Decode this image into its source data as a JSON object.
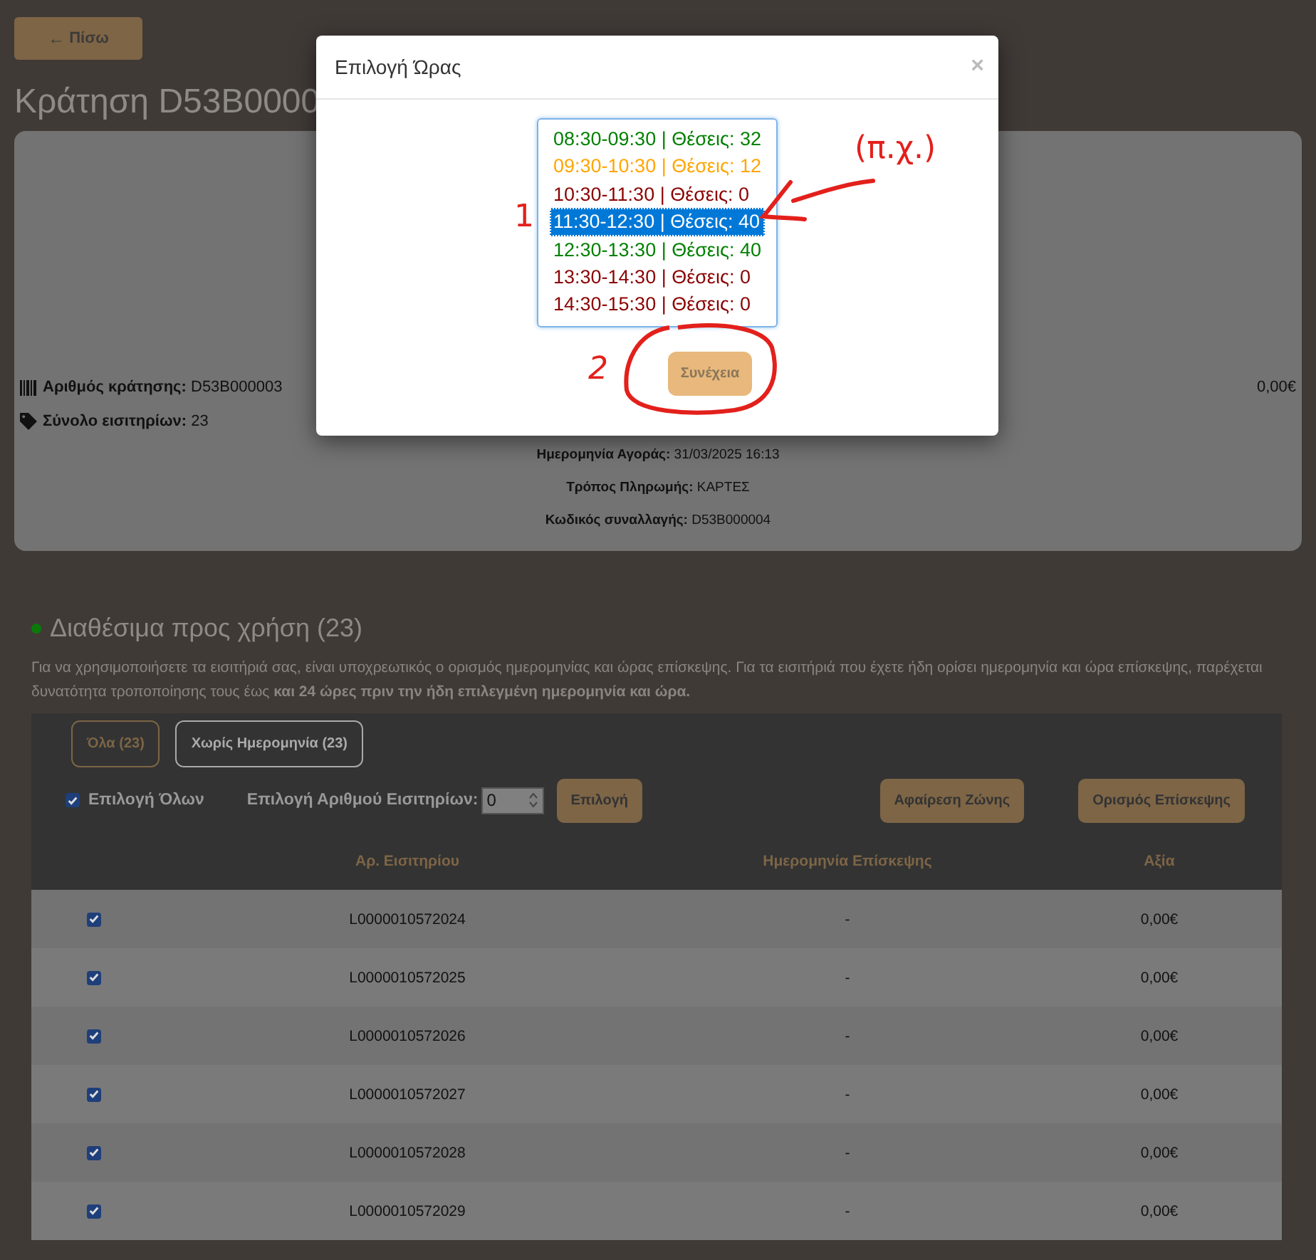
{
  "back_button": {
    "icon": "←",
    "label": "Πίσω"
  },
  "title": "Κράτηση D53B0000",
  "booking": {
    "number": "**Αριθμός κράτησης:** D53B000003",
    "total_tickets": "**Σύνολο εισιτηρίων:** 23",
    "amount": "0,00€",
    "details": [
      "**Ημερομηνία Αγοράς:** 31/03/2025 16:13",
      "**Τρόπος Πληρωμής:** ΚΑΡΤΕΣ",
      "**Κωδικός συναλλαγής:** D53B000004"
    ]
  },
  "section": {
    "title": "Διαθέσιμα προς χρήση (23)",
    "note": "Για να χρησιμοποιήσετε τα εισιτήριά σας, είναι υποχρεωτικός ο ορισμός ημερομηνίας και ώρας επίσκεψης. Για τα εισιτήριά που έχετε ήδη ορίσει ημερομηνία και ώρα επίσκεψης, παρέχεται δυνατότητα τροποποίησης τους έως **και 24 ώρες πριν την ήδη επιλεγμένη ημερομηνία και ώρα.**"
  },
  "filters": [
    {
      "label": "Όλα (23)",
      "selected": true
    },
    {
      "label": "Χωρίς Ημερομηνία (23)",
      "selected": false
    }
  ],
  "select_all": {
    "label": "Επιλογή Όλων",
    "checked": true
  },
  "count_field": {
    "label": "Επιλογή Αριθμού Εισιτηρίων:",
    "value": "0"
  },
  "actions": [
    "Επιλογή",
    "Αφαίρεση Ζώνης",
    "Ορισμός Επίσκεψης"
  ],
  "table": {
    "columns": [
      "Αρ. Εισιτηρίου",
      "Ημερομηνία Επίσκεψης",
      "Αξία"
    ],
    "rows": [
      {
        "checked": true,
        "cells": [
          "L0000010572024",
          "-",
          "0,00€"
        ]
      },
      {
        "checked": true,
        "cells": [
          "L0000010572025",
          "-",
          "0,00€"
        ]
      },
      {
        "checked": true,
        "cells": [
          "L0000010572026",
          "-",
          "0,00€"
        ]
      },
      {
        "checked": true,
        "cells": [
          "L0000010572027",
          "-",
          "0,00€"
        ]
      },
      {
        "checked": true,
        "cells": [
          "L0000010572028",
          "-",
          "0,00€"
        ]
      },
      {
        "checked": true,
        "cells": [
          "L0000010572029",
          "-",
          "0,00€"
        ]
      }
    ]
  },
  "modal": {
    "title": "Επιλογή Ώρας",
    "close": "×",
    "options": [
      {
        "label": "08:30-09:30 | Θέσεις: 32",
        "color": "#008000",
        "selected": false
      },
      {
        "label": "09:30-10:30 | Θέσεις: 12",
        "color": "#ffa500",
        "selected": false
      },
      {
        "label": "10:30-11:30 | Θέσεις: 0",
        "color": "#8b0000",
        "selected": false
      },
      {
        "label": "11:30-12:30 | Θέσεις: 40",
        "selected": true
      },
      {
        "label": "12:30-13:30 | Θέσεις: 40",
        "color": "#008000",
        "selected": false
      },
      {
        "label": "13:30-14:30 | Θέσεις: 0",
        "color": "#8b0000",
        "selected": false
      },
      {
        "label": "14:30-15:30 | Θέσεις: 0",
        "color": "#8b0000",
        "selected": false
      }
    ],
    "button": "Συνέχεια"
  },
  "annotations": {
    "step_one": "1",
    "step_two": "2",
    "example": "(π.χ.)"
  }
}
